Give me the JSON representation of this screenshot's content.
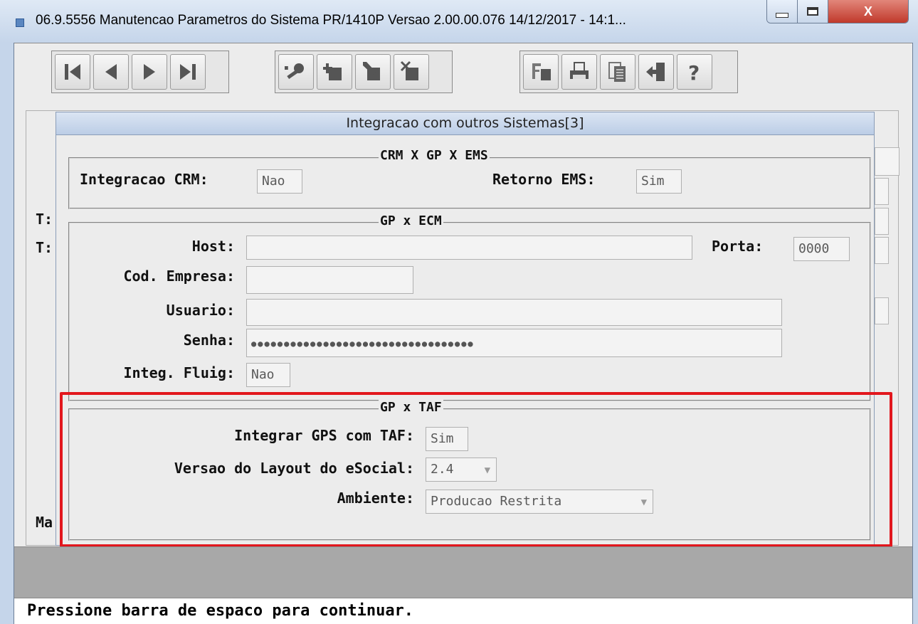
{
  "window": {
    "title": "06.9.5556 Manutencao  Parametros do Sistema PR/1410P Versao 2.00.00.076 14/12/2017 - 14:1...",
    "close_label": "X"
  },
  "toolbar": {
    "nav_icons": [
      "first-record-icon",
      "previous-record-icon",
      "next-record-icon",
      "last-record-icon"
    ],
    "edit_icons": [
      "key-icon",
      "add-icon",
      "edit-icon",
      "delete-icon"
    ],
    "util_icons": [
      "filter-icon",
      "print-icon",
      "copy-icon",
      "exit-icon",
      "help-icon"
    ]
  },
  "background": {
    "label_t1": "T:",
    "label_t2": "T:",
    "label_m": "Ma"
  },
  "dialog": {
    "title": "Integracao com outros Sistemas[3]",
    "crm": {
      "title": "CRM X GP X EMS",
      "integracao_crm_label": "Integracao CRM:",
      "integracao_crm_value": "Nao",
      "retorno_ems_label": "Retorno EMS:",
      "retorno_ems_value": "Sim"
    },
    "ecm": {
      "title": "GP x ECM",
      "host_label": "Host:",
      "host_value": "",
      "porta_label": "Porta:",
      "porta_value": "0000",
      "cod_empresa_label": "Cod. Empresa:",
      "cod_empresa_value": "",
      "usuario_label": "Usuario:",
      "usuario_value": "",
      "senha_label": "Senha:",
      "senha_value": "●●●●●●●●●●●●●●●●●●●●●●●●●●●●●●●●●●",
      "integ_fluig_label": "Integ. Fluig:",
      "integ_fluig_value": "Nao"
    },
    "taf": {
      "title": "GP x TAF",
      "integrar_label": "Integrar GPS com TAF:",
      "integrar_value": "Sim",
      "versao_label": "Versao do Layout do eSocial:",
      "versao_value": "2.4",
      "ambiente_label": "Ambiente:",
      "ambiente_value": "Producao Restrita"
    }
  },
  "status": {
    "message": "Pressione barra de espaco para continuar."
  },
  "colors": {
    "highlight": "#e2171d"
  }
}
